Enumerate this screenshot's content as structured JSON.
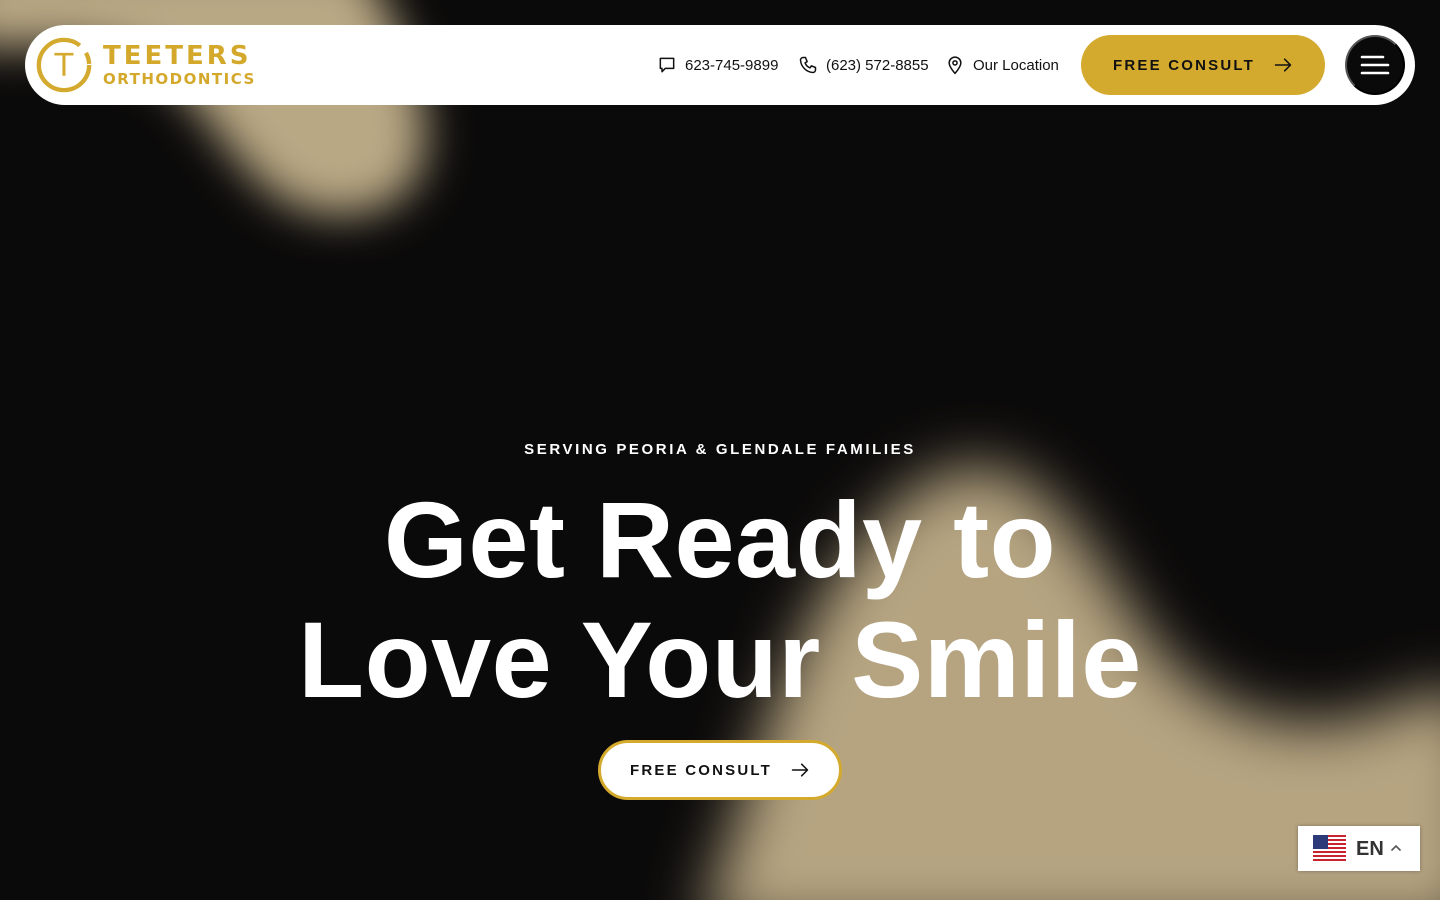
{
  "brand": {
    "name": "TEETERS",
    "subtitle": "ORTHODONTICS",
    "mark_letter": "T",
    "gold": "#d4aa2e"
  },
  "header": {
    "contacts": [
      {
        "icon": "chat-bubble-icon",
        "text": "623-745-9899"
      },
      {
        "icon": "phone-icon",
        "text": "(623) 572-8855"
      },
      {
        "icon": "map-pin-icon",
        "text": "Our Location"
      }
    ],
    "cta_label": "FREE CONSULT",
    "menu_icon": "hamburger-icon"
  },
  "hero": {
    "eyebrow": "SERVING PEORIA & GLENDALE FAMILIES",
    "headline_line1": "Get Ready to",
    "headline_line2": "Love Your Smile",
    "cta_label": "FREE CONSULT"
  },
  "language": {
    "code": "EN",
    "flag": "us-flag-icon"
  },
  "colors": {
    "background": "#0b0a0a",
    "sand": "#b7a582",
    "white": "#ffffff"
  }
}
